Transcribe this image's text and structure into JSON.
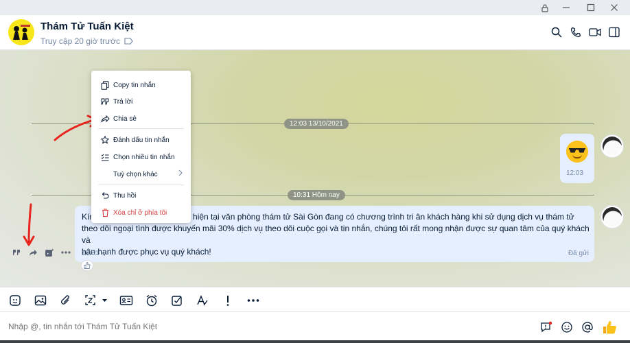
{
  "window": {
    "controls": [
      "lock-icon",
      "minimize-icon",
      "maximize-icon",
      "close-icon"
    ]
  },
  "header": {
    "name": "Thám Tử Tuấn Kiệt",
    "status": "Truy cập 20 giờ trước",
    "icons": [
      "search-icon",
      "phone-icon",
      "video-icon",
      "sidebar-toggle-icon"
    ]
  },
  "chat": {
    "separators": [
      {
        "label": "12:03 13/10/2021"
      },
      {
        "label": "10:31 Hôm nay"
      }
    ],
    "sticker_message": {
      "emoji": "sunglasses-emoji",
      "time": "12:03"
    },
    "text_message": {
      "text": "Kính ...thiết, hiện tại văn phòng thám tử Sài Gòn đang có chương trình tri ân khách hàng khi sử dụng dịch vụ thám tử theo dõi ngoại tình được khuyến mãi 30% dịch vụ theo dõi cuộc gọi và tin nhắn, chúng tôi rất mong nhận được sự quan tâm của quý khách và hân hạnh được phục vụ quý khách!",
      "visible_start": "Kín",
      "visible_rest": "hiết, hiện tại văn phòng thám tử Sài Gòn đang có chương trình tri ân khách hàng khi sử dụng dịch vụ thám tử",
      "line2": "theo dõi ngoại tình được khuyến mãi 30% dịch vụ theo dõi cuộc gọi và tin nhắn, chúng tôi rất mong nhận được sự quan tâm của quý khách và",
      "line3": "hân hạnh được phục vụ quý khách!",
      "time": "10:31",
      "status": "Đã gửi"
    }
  },
  "context_menu": {
    "items": [
      {
        "label": "Copy tin nhắn",
        "icon": "copy-icon"
      },
      {
        "label": "Trả lời",
        "icon": "quote-icon"
      },
      {
        "label": "Chia sẻ",
        "icon": "share-icon"
      },
      {
        "label": "Đánh dấu tin nhắn",
        "icon": "star-icon"
      },
      {
        "label": "Chọn nhiều tin nhắn",
        "icon": "checklist-icon"
      },
      {
        "label": "Tuỳ chọn khác",
        "icon": "",
        "submenu": true
      },
      {
        "label": "Thu hồi",
        "icon": "undo-icon"
      },
      {
        "label": "Xóa chỉ ở phía tôi",
        "icon": "trash-icon",
        "danger": true
      }
    ]
  },
  "hover_actions": [
    "quote-icon",
    "share-icon",
    "edit-icon",
    "more-icon"
  ],
  "toolbar": [
    "sticker-icon",
    "image-icon",
    "attach-icon",
    "screenshot-icon",
    "contact-card-icon",
    "reminder-icon",
    "todo-icon",
    "format-text-icon",
    "important-icon",
    "more-icon"
  ],
  "composer": {
    "placeholder": "Nhập @, tin nhắn tới Thám Tử Tuấn Kiệt",
    "icons": [
      "quick-message-icon",
      "emoji-icon",
      "mention-icon",
      "thumbs-up-icon"
    ]
  },
  "colors": {
    "accent": "#0068ff",
    "bubble": "#e5efff",
    "danger": "#d63d3d",
    "annotation": "#e8261f"
  }
}
